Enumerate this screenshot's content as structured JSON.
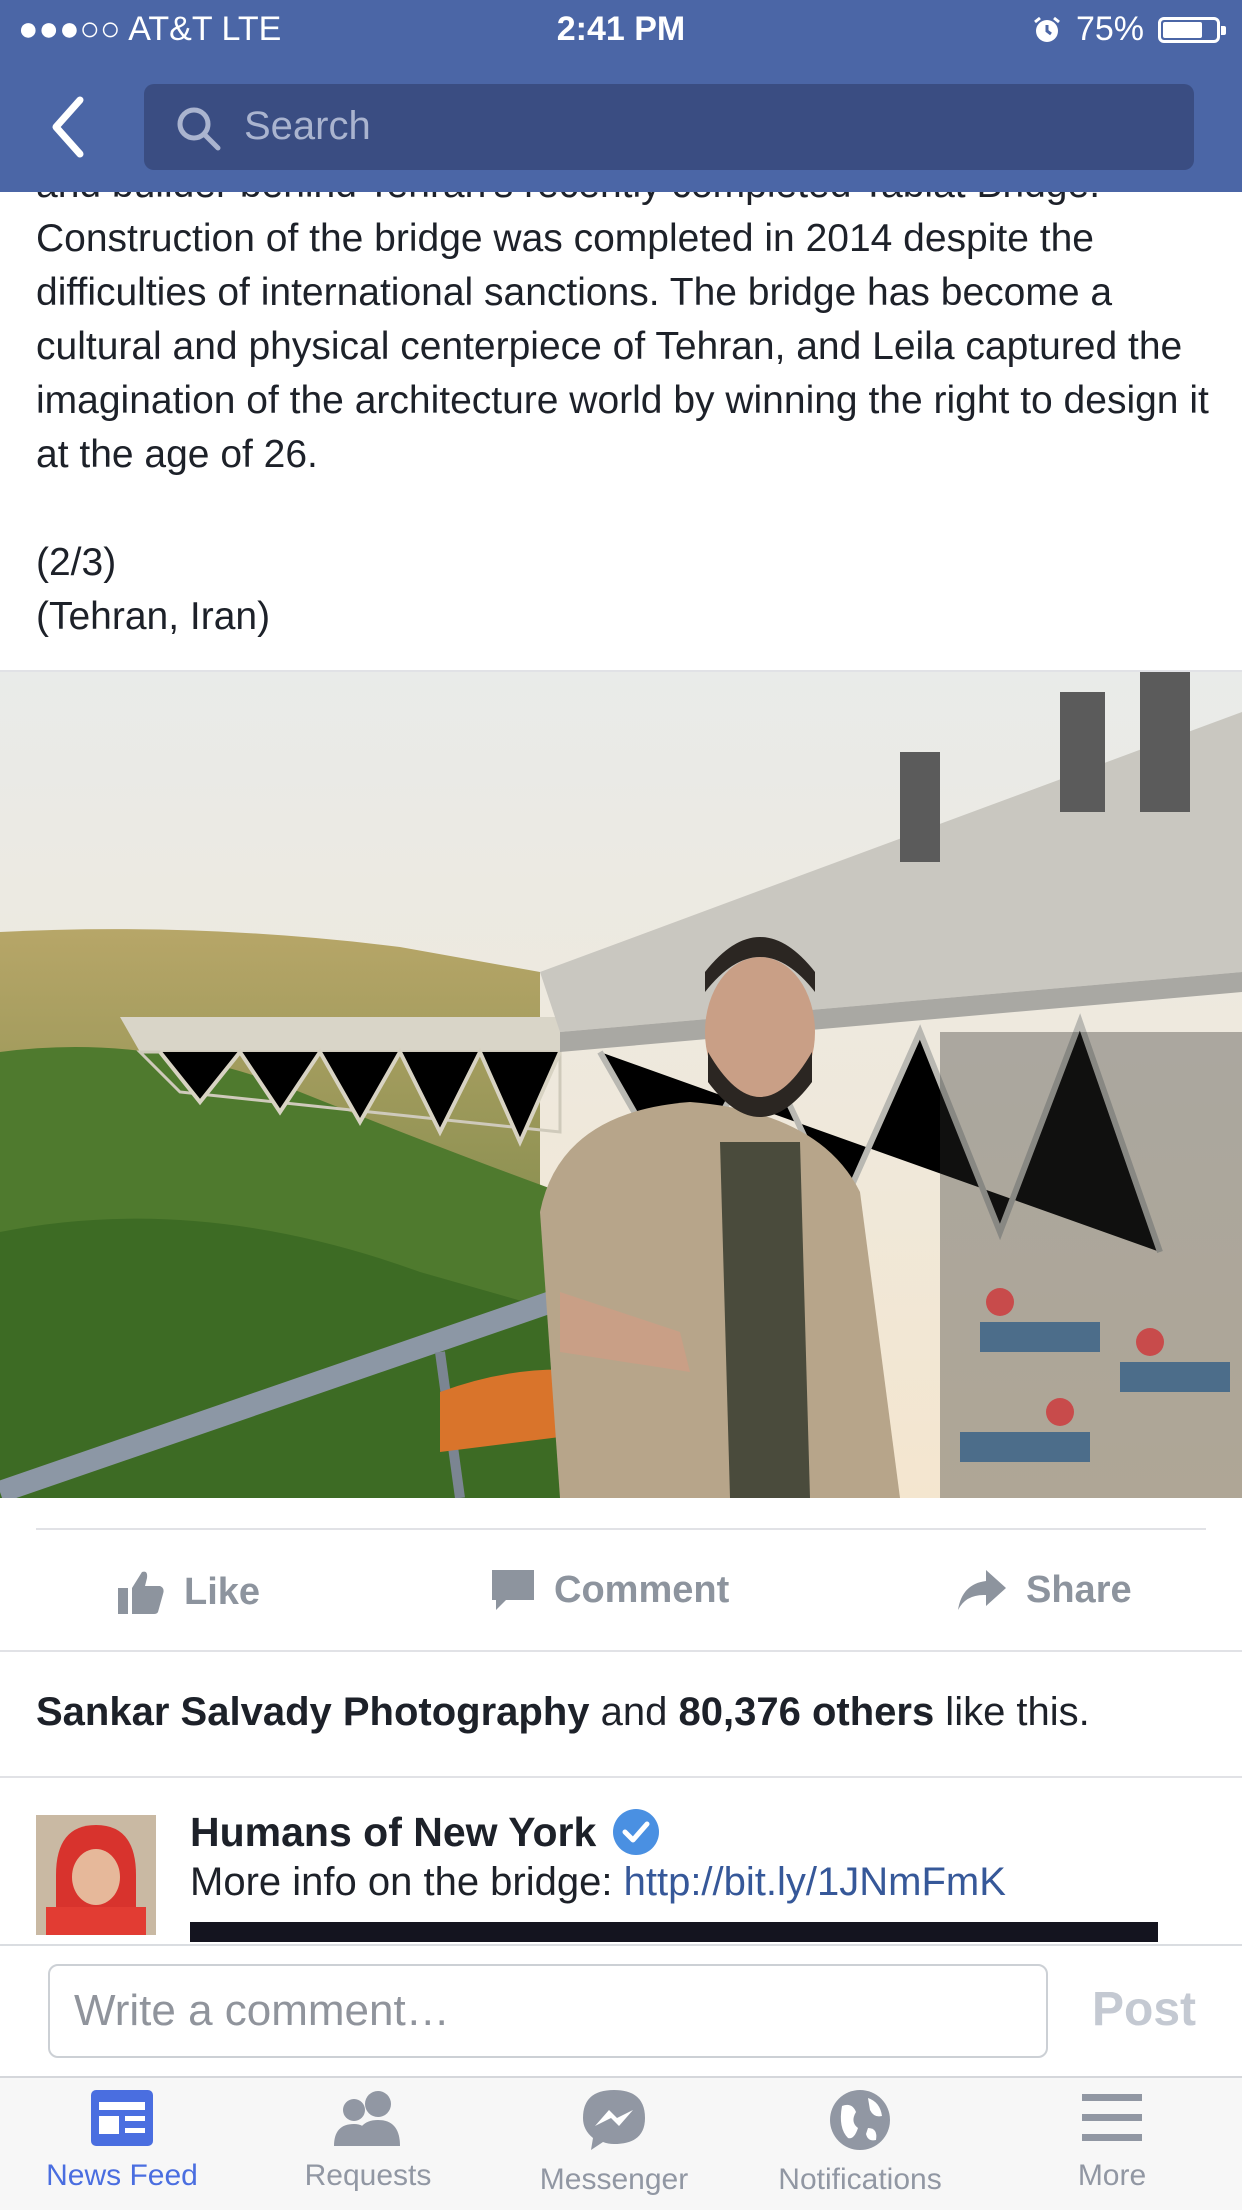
{
  "status_bar": {
    "carrier": "●●●○○ AT&T  LTE",
    "time": "2:41 PM",
    "battery_text": "75%",
    "battery_level": 0.75
  },
  "nav": {
    "search_placeholder": "Search"
  },
  "post": {
    "cut_line": "and builder behind Tehran's recently completed Tabiat Bridge.",
    "body": "Construction of the bridge was completed in 2014 despite the difficulties of international sanctions. The bridge has become a cultural and physical centerpiece of Tehran, and Leila captured the imagination of the architecture world by winning the right to design it at the age of 26.",
    "part": "(2/3)",
    "location": "(Tehran, Iran)"
  },
  "actions": {
    "like": "Like",
    "comment": "Comment",
    "share": "Share"
  },
  "likes": {
    "name": "Sankar Salvady Photography",
    "middle": " and ",
    "count": "80,376 others",
    "suffix": " like this."
  },
  "comment": {
    "author": "Humans of New York",
    "text": "More info on the bridge: ",
    "link": "http://bit.ly/1JNmFmK"
  },
  "composer": {
    "placeholder": "Write a comment…",
    "post_label": "Post"
  },
  "tabs": [
    {
      "label": "News Feed",
      "icon": "news-feed-icon"
    },
    {
      "label": "Requests",
      "icon": "friends-icon"
    },
    {
      "label": "Messenger",
      "icon": "messenger-icon"
    },
    {
      "label": "Notifications",
      "icon": "globe-icon"
    },
    {
      "label": "More",
      "icon": "menu-icon"
    }
  ],
  "colors": {
    "brand": "#4b66a6",
    "link": "#365899",
    "active_tab": "#4a6ee0"
  }
}
